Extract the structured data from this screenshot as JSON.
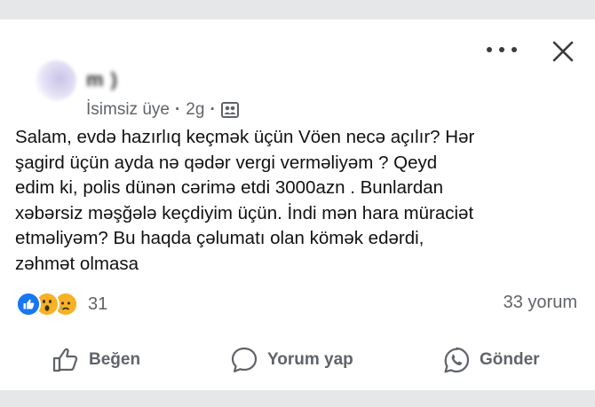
{
  "post": {
    "author_name": "m           )",
    "group_role": "İsimsiz üye",
    "time": "2g",
    "separator": "·",
    "text": "Salam, evdə hazırlıq keçmək üçün Vöen necə açılır? Hər\nşagird üçün ayda nə qədər vergi verməliyəm ? Qeyd\nedim ki, polis dünən cərimə etdi 3000azn . Bunlardan\nxəbərsiz məşğələ keçdiyim üçün. İndi mən hara müraciət\netməliyəm? Bu haqda çəlumatı olan kömək edərdi,\nzəhmət olmasa"
  },
  "reactions": {
    "count": "31",
    "types": [
      "like-icon",
      "wow-icon",
      "sad-icon"
    ]
  },
  "comments": {
    "count_label": "33 yorum"
  },
  "actions": {
    "like_label": "Beğen",
    "comment_label": "Yorum yap",
    "share_label": "Gönder"
  },
  "colors": {
    "like_blue": "#1877f2",
    "reaction_yellow": "#f7b125",
    "secondary_text": "#5f6469"
  }
}
